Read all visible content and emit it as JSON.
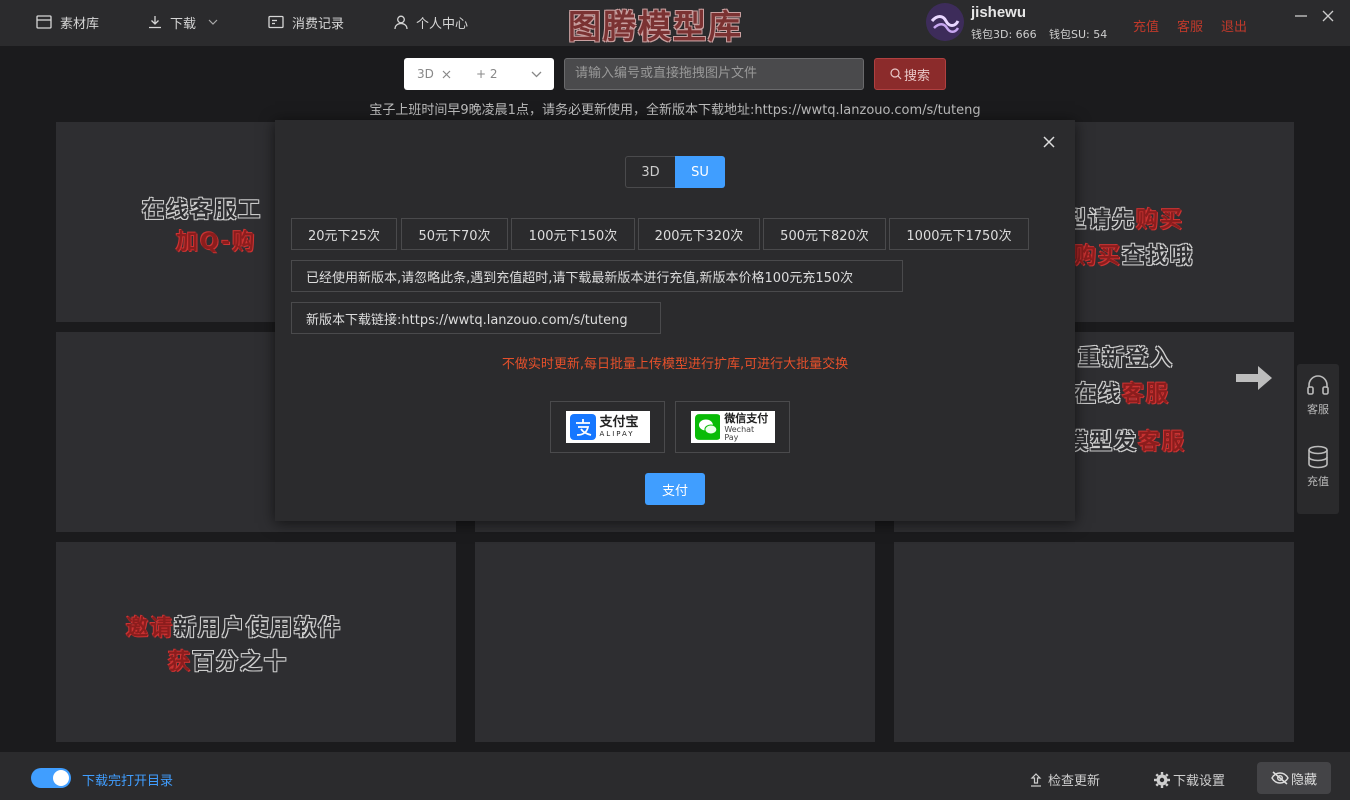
{
  "nav": {
    "items": [
      "素材库",
      "下载",
      "消费记录",
      "个人中心"
    ]
  },
  "app_title": "图腾模型库",
  "user": {
    "name": "jishewu",
    "wallet_3d": "钱包3D: 666",
    "wallet_su": "钱包SU: 54"
  },
  "top_links": [
    "充值",
    "客服",
    "退出"
  ],
  "search": {
    "tag": "3D",
    "tag_more": "+ 2",
    "placeholder": "请输入编号或直接拖拽图片文件",
    "button": "搜索"
  },
  "notice": "宝子上班时间早9晚凌晨1点，请务必更新使用，全新版本下载地址:https://wwtq.lanzouo.com/s/tuteng",
  "cards": {
    "c1_line1": "在线客服工",
    "c1_line2": "加Q-购",
    "c2_line1a": "型请先",
    "c2_line1b": "购买",
    "c2_line2a": "购买",
    "c2_line2b": "查找哦",
    "c3_line1": "重新登入",
    "c3_line2a": "在线",
    "c3_line2b": "客服",
    "c3_line3a": "模型发",
    "c3_line3b": "客服",
    "c4_line1a": "邀请",
    "c4_line1b": "新用户使用软件",
    "c4_line2a": "获",
    "c4_line2b": "百分之十"
  },
  "side_panel": [
    "客服",
    "充值"
  ],
  "modal": {
    "tabs": [
      "3D",
      "SU"
    ],
    "active_tab": "SU",
    "prices": [
      "20元下25次",
      "50元下70次",
      "100元下150次",
      "200元下320次",
      "500元下820次",
      "1000元下1750次"
    ],
    "info1": "已经使用新版本,请忽略此条,遇到充值超时,请下载最新版本进行充值,新版本价格100元充150次",
    "info2": "新版本下载链接:https://wwtq.lanzouo.com/s/tuteng",
    "warning": "不做实时更新,每日批量上传模型进行扩库,可进行大批量交换",
    "alipay_cn": "支付宝",
    "alipay_en": "ALIPAY",
    "wechat_cn": "微信支付",
    "wechat_en": "Wechat Pay",
    "pay_button": "支付"
  },
  "footer": {
    "toggle_label": "下载完打开目录",
    "check_update": "检查更新",
    "download_settings": "下载设置",
    "hide": "隐藏"
  },
  "colors": {
    "accent": "#409eff",
    "danger": "#c0392b",
    "warning": "#e6502b"
  }
}
